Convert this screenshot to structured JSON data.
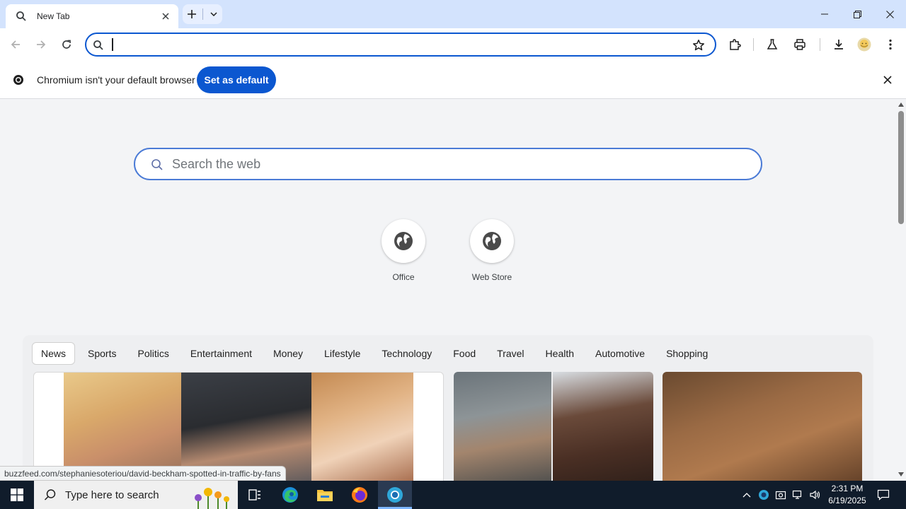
{
  "window": {
    "tab_title": "New Tab",
    "new_tab_symbol": "+",
    "controls": [
      "minimize",
      "restore",
      "close"
    ]
  },
  "toolbar": {
    "omnibox_value": "",
    "icons": [
      "back-icon",
      "forward-icon",
      "reload-icon",
      "search-icon",
      "star-icon",
      "extensions-icon",
      "labs-icon",
      "print-icon",
      "download-icon",
      "profile-avatar",
      "menu-icon"
    ]
  },
  "infobar": {
    "message": "Chromium isn't your default browser",
    "button_label": "Set as default"
  },
  "new_tab_page": {
    "search_placeholder": "Search the web",
    "shortcuts": [
      {
        "label": "Office",
        "icon": "globe-icon"
      },
      {
        "label": "Web Store",
        "icon": "globe-icon"
      }
    ],
    "feed_tabs": [
      "News",
      "Sports",
      "Politics",
      "Entertainment",
      "Money",
      "Lifestyle",
      "Technology",
      "Food",
      "Travel",
      "Health",
      "Automotive",
      "Shopping"
    ],
    "active_feed_tab": "News"
  },
  "status_bar": {
    "url": "buzzfeed.com/stephaniesoteriou/david-beckham-spotted-in-traffic-by-fans"
  },
  "taskbar": {
    "search_placeholder": "Type here to search",
    "time": "2:31 PM",
    "date": "6/19/2025"
  },
  "colors": {
    "accent": "#0b57d0",
    "titlebar": "#d3e3fd",
    "taskbar": "#101c2b"
  }
}
